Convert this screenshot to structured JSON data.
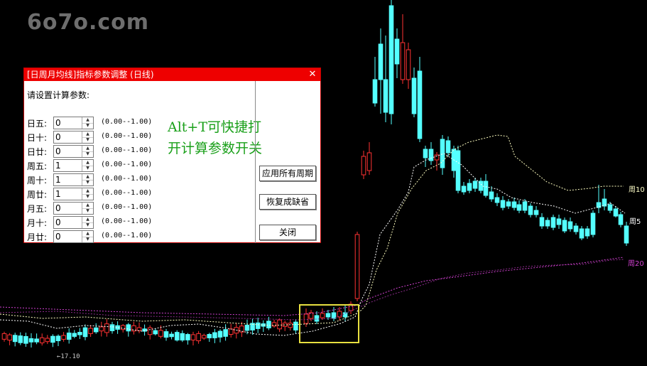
{
  "watermark": "6o7o.com",
  "dialog": {
    "title": "[日周月均线]指标参数调整 (日线)",
    "close_glyph": "✕",
    "prompt": "请设置计算参数:",
    "params": [
      {
        "label": "日五:",
        "value": "0",
        "range": "(0.00--1.00)"
      },
      {
        "label": "日十:",
        "value": "0",
        "range": "(0.00--1.00)"
      },
      {
        "label": "日廿:",
        "value": "0",
        "range": "(0.00--1.00)"
      },
      {
        "label": "周五:",
        "value": "1",
        "range": "(0.00--1.00)"
      },
      {
        "label": "周十:",
        "value": "1",
        "range": "(0.00--1.00)"
      },
      {
        "label": "周廿:",
        "value": "1",
        "range": "(0.00--1.00)"
      },
      {
        "label": "月五:",
        "value": "0",
        "range": "(0.00--1.00)"
      },
      {
        "label": "月十:",
        "value": "0",
        "range": "(0.00--1.00)"
      },
      {
        "label": "月廿:",
        "value": "0",
        "range": "(0.00--1.00)"
      }
    ],
    "note_line1": "Alt+T可快捷打",
    "note_line2": "开计算参数开关",
    "buttons": {
      "apply_all": "应用所有周期",
      "restore_default": "恢复成缺省",
      "close": "关闭"
    }
  },
  "chart": {
    "ma_labels": [
      {
        "text": "周10",
        "color": "#ffffc8"
      },
      {
        "text": "周5",
        "color": "#ffffff"
      },
      {
        "text": "周20",
        "color": "#d040d0"
      }
    ],
    "low_label": "17.10",
    "colors": {
      "up": "#ff3232",
      "down": "#54ffff",
      "highlight": "#e8e040",
      "ma_week5": "#ffffff",
      "ma_week10": "#ffffc0",
      "ma_week20": "#d040d0"
    }
  }
}
